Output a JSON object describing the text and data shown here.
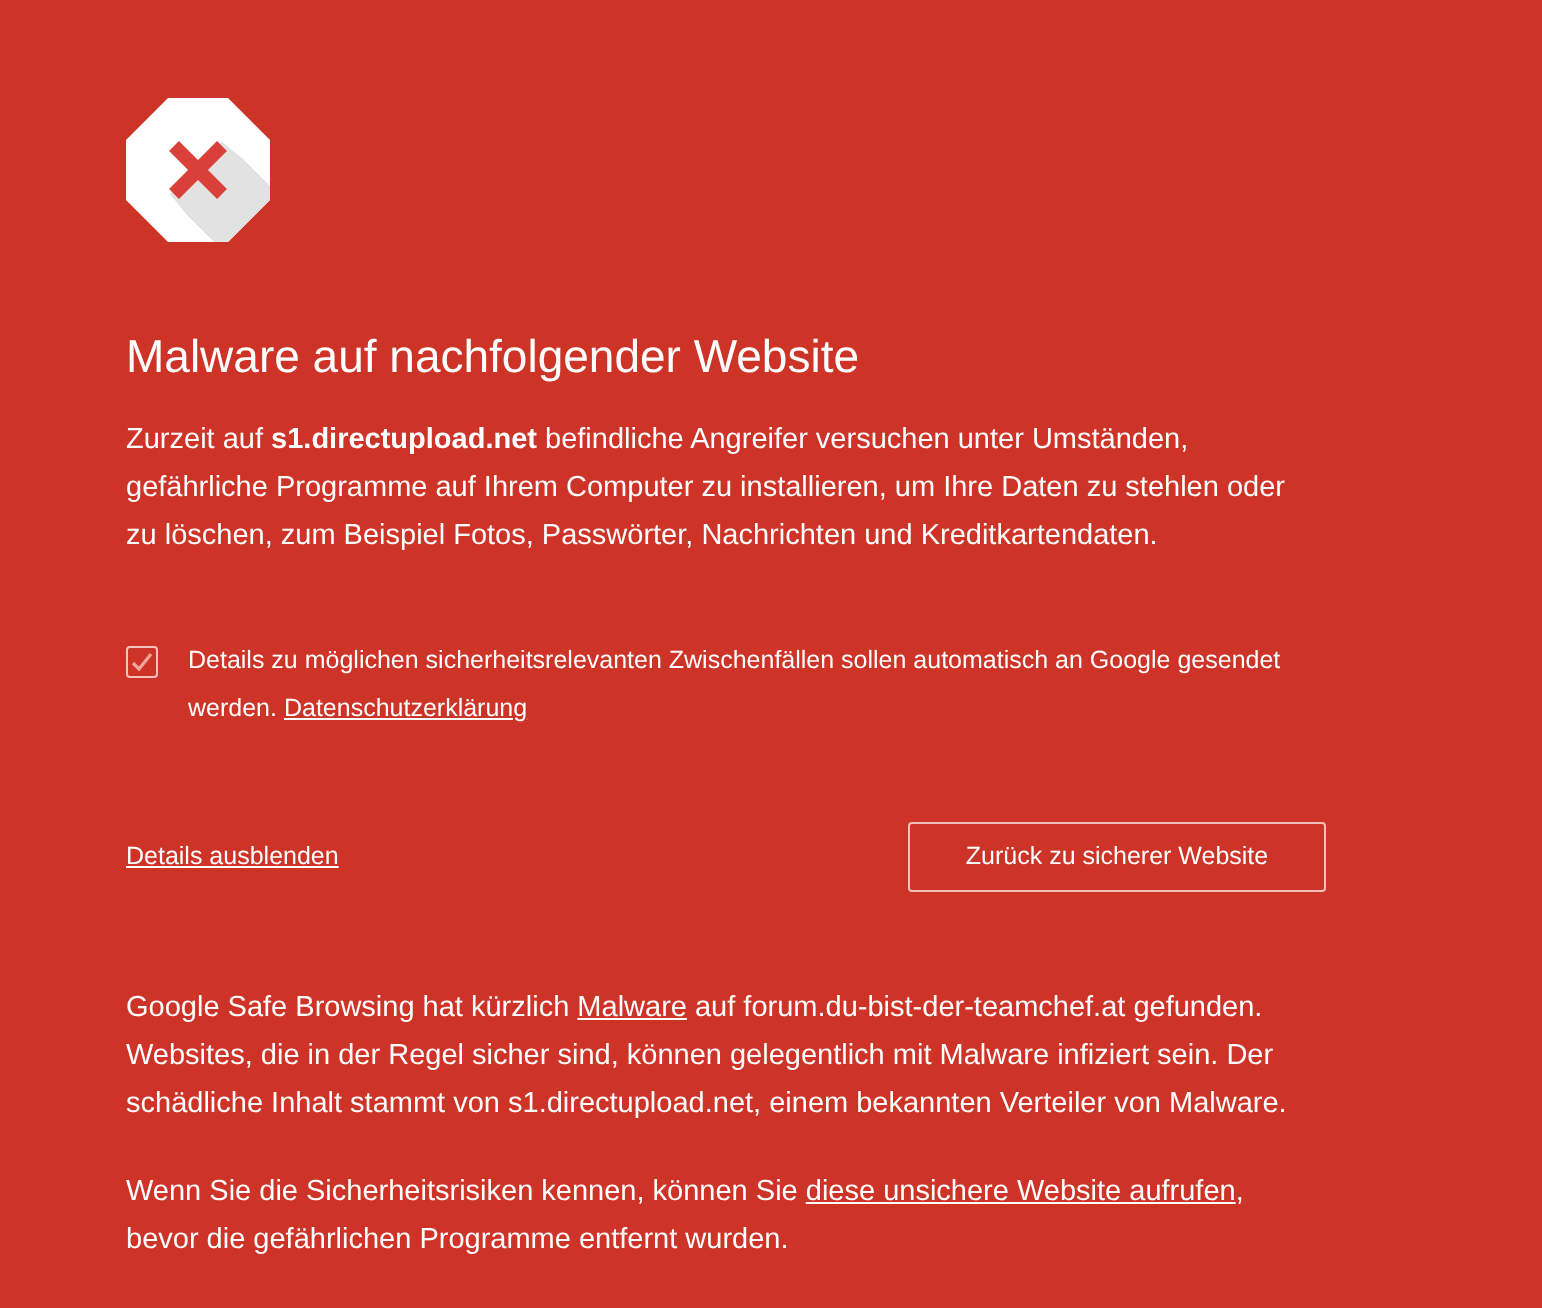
{
  "title": "Malware auf nachfolgender Website",
  "intro": "Zurzeit auf **s1.directupload.net** befindliche Angreifer versuchen unter Umständen, gefährliche Programme auf Ihrem Computer zu installieren, um Ihre Daten zu stehlen oder zu löschen, zum Beispiel Fotos, Passwörter, Nachrichten und Kreditkartendaten.",
  "report_option": {
    "checked": true,
    "text": "Details zu möglichen sicherheitsrelevanten Zwischenfällen sollen automatisch an Google gesendet werden.",
    "link": "Datenschutzerklärung"
  },
  "details_link": "Details ausblenden",
  "back_button": "Zurück zu sicherer Website",
  "details": [
    {
      "before": "Google Safe Browsing hat kürzlich ",
      "link": "Malware",
      "after": " auf forum.du-bist-der-teamchef.at gefunden. Websites, die in der Regel sicher sind, können gelegentlich mit Malware infiziert sein. Der schädliche Inhalt stammt von s1.directupload.net, einem bekannten Verteiler von Malware."
    },
    {
      "before": "Wenn Sie die Sicherheitsrisiken kennen, können Sie ",
      "link": "diese unsichere Website aufrufen",
      "after": ", bevor die gefährlichen Programme entfernt wurden."
    }
  ]
}
